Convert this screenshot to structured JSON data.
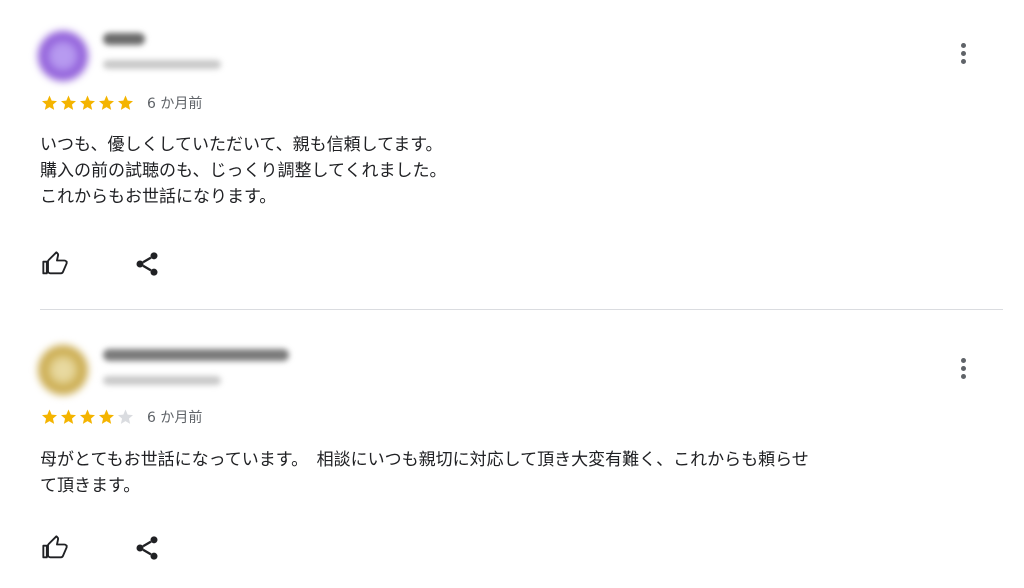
{
  "colors": {
    "star_filled": "#f4b400",
    "star_empty": "#dadce0",
    "text": "#202124",
    "muted": "#5f6368",
    "divider": "#dadce0"
  },
  "reviews": [
    {
      "avatar_color": "#8e5bd8",
      "rating": 5,
      "max_rating": 5,
      "time_label": "6 か月前",
      "text": "いつも、優しくしていただいて、親も信頼してます。\n購入の前の試聴のも、じっくり調整してくれました。\nこれからもお世話になります。",
      "more_icon": "more-vert-icon",
      "like_icon": "thumb-up-icon",
      "share_icon": "share-icon"
    },
    {
      "avatar_color": "#c9a94a",
      "rating": 4,
      "max_rating": 5,
      "time_label": "6 か月前",
      "text": "母がとてもお世話になっています。　相談にいつも親切に対応して頂き大変有難く、これからも頼らせ\nて頂きます。",
      "more_icon": "more-vert-icon",
      "like_icon": "thumb-up-icon",
      "share_icon": "share-icon"
    }
  ]
}
